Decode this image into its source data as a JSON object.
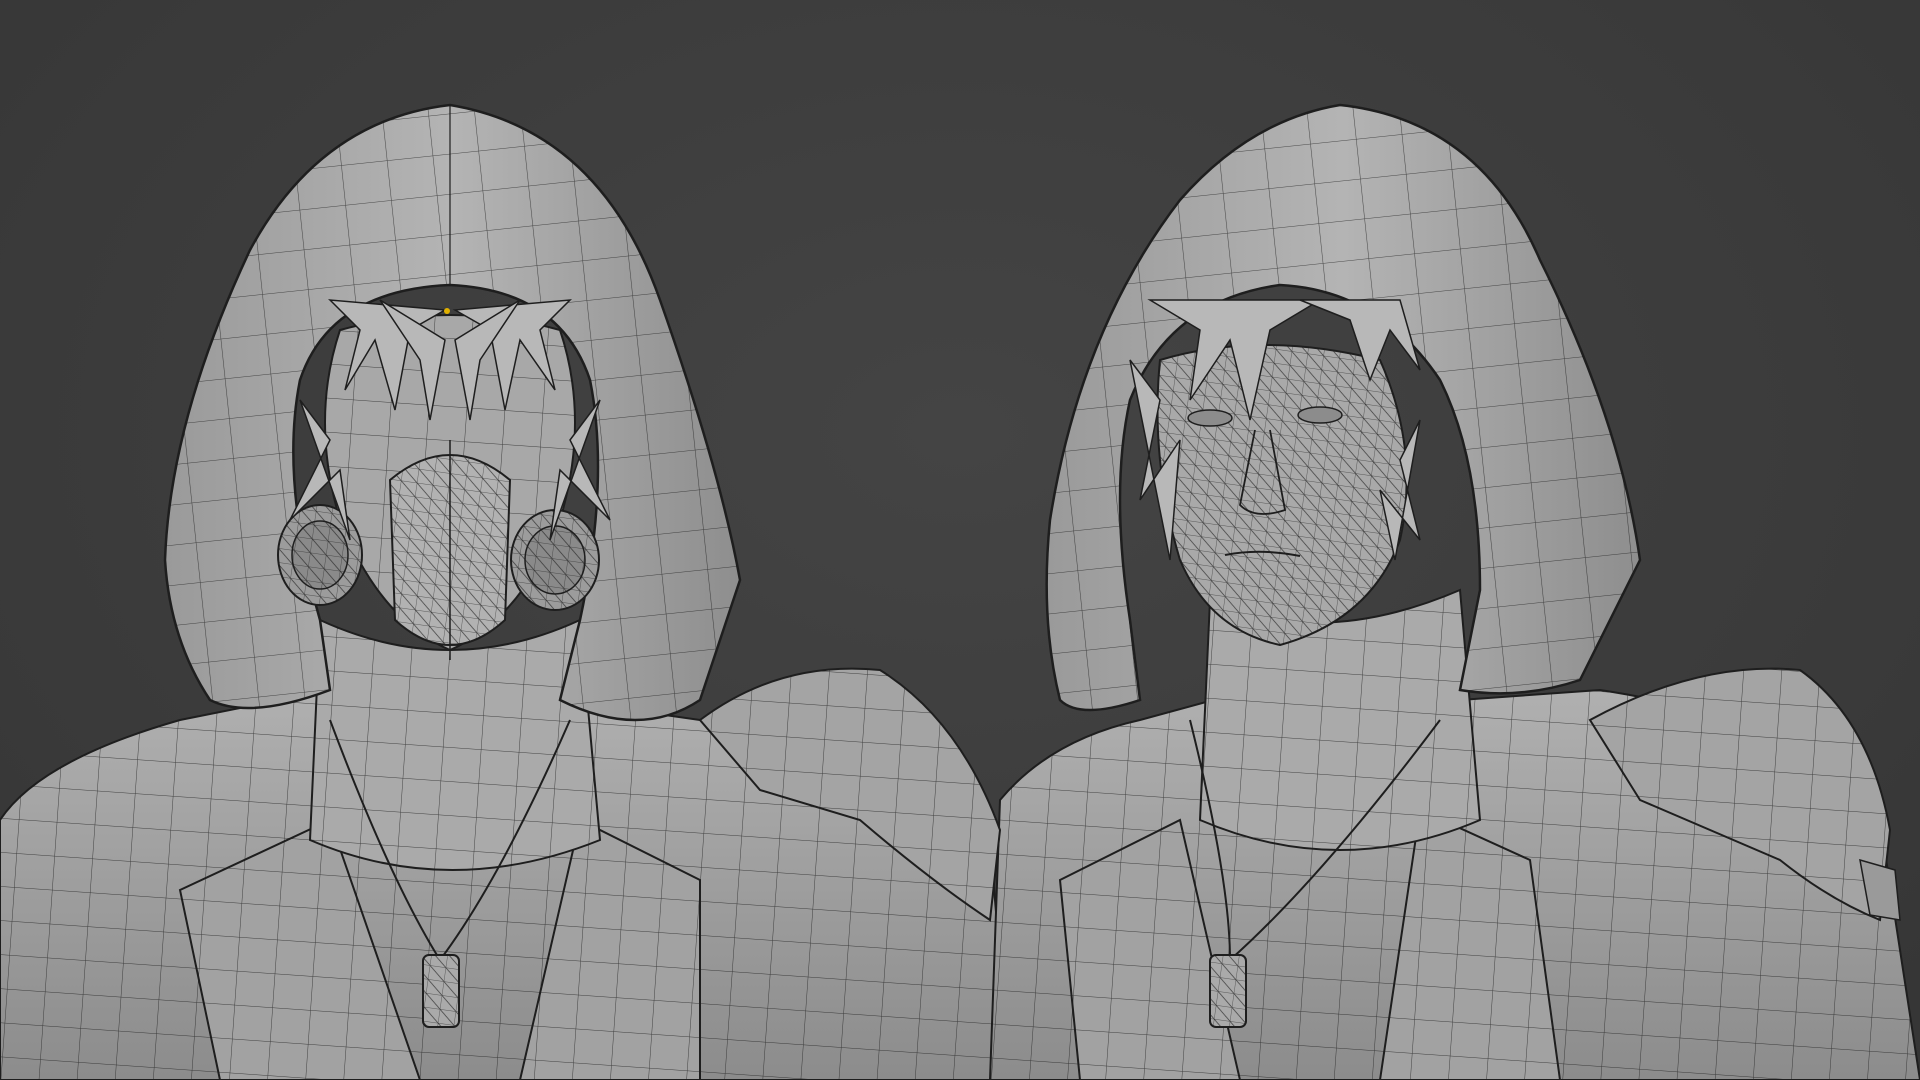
{
  "scene": {
    "background_color": "#3d3d3d",
    "mesh_fill_color": "#a6a6a6",
    "mesh_shadow_color": "#6e6e6e",
    "wire_color": "#1e1e1e",
    "origin_dot_color": "#e0b000"
  },
  "models": [
    {
      "name": "masked-hooded-figure",
      "features": [
        "hood",
        "mask",
        "respirator-filters",
        "spiky-hair",
        "coat",
        "dog-tag-necklace"
      ]
    },
    {
      "name": "unmasked-hooded-figure",
      "features": [
        "hood",
        "face",
        "spiky-hair",
        "coat",
        "shoulder-armor",
        "dog-tag-necklace"
      ]
    }
  ]
}
